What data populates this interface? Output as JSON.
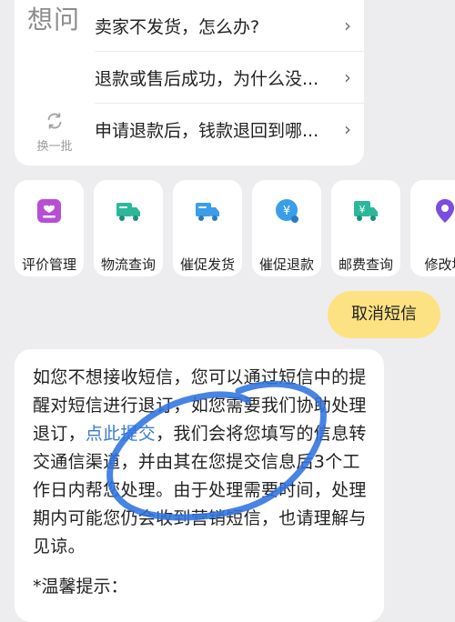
{
  "faq": {
    "title": "想问",
    "refresh_label": "换一批",
    "items": [
      {
        "text": "卖家不发货，怎么办?"
      },
      {
        "text": "退款或售后成功，为什么没..."
      },
      {
        "text": "申请退款后，钱款退回到哪..."
      }
    ]
  },
  "actions": [
    {
      "label": "评价管理",
      "icon": "review-icon",
      "color": "#b64fd6"
    },
    {
      "label": "物流查询",
      "icon": "truck-icon",
      "color": "#2bb89a"
    },
    {
      "label": "催促发货",
      "icon": "truck-icon",
      "color": "#3b9ee8"
    },
    {
      "label": "催促退款",
      "icon": "yen-refund-icon",
      "color": "#3b9ee8"
    },
    {
      "label": "邮费查询",
      "icon": "yen-truck-icon",
      "color": "#2bb89a"
    },
    {
      "label": "修改地",
      "icon": "location-icon",
      "color": "#7b4de0"
    }
  ],
  "cancel_button": {
    "label": "取消短信"
  },
  "message": {
    "part1": "如您不想接收短信，您可以通过短信中的提醒对短信进行退订，如您需要我们协助处理退订，",
    "link": "点此提交",
    "part2": "，我们会将您填写的信息转交通信渠道，并由其在您提交信息后3个工作日内帮您处理。由于处理需要时间，处理期内可能您仍会收到营销短信，也请理解与见谅。",
    "tip": "*温馨提示："
  },
  "colors": {
    "background": "#ededf0",
    "button_yellow": "#fde283",
    "link_blue": "#3a7cd0",
    "scribble_blue": "#2f73e0"
  }
}
